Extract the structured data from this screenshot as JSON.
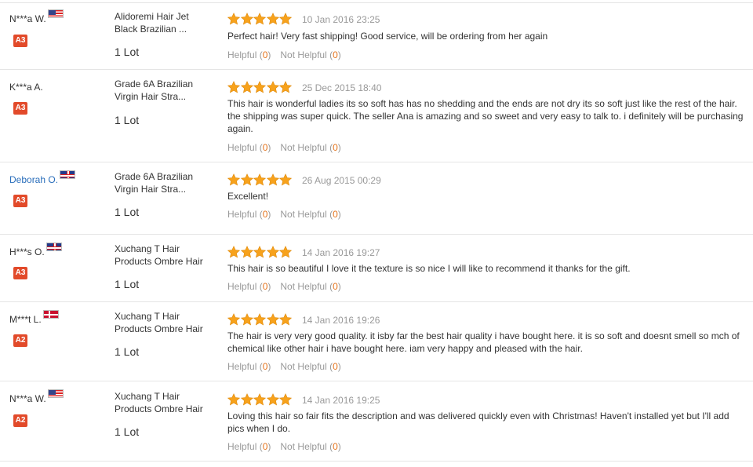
{
  "reviews": [
    {
      "user": "N***a W.",
      "flag": "flag-us",
      "badge": "A3",
      "is_link": false,
      "product": "Alidoremi Hair Jet Black Brazilian ...",
      "quantity": "1 Lot",
      "rating": 5,
      "date": "10 Jan 2016 23:25",
      "text": "Perfect hair! Very fast shipping! Good service, will be ordering from her again",
      "helpful_label": "Helpful",
      "helpful_count": "0",
      "not_helpful_label": "Not Helpful",
      "not_helpful_count": "0"
    },
    {
      "user": "K***a A.",
      "flag": "",
      "badge": "A3",
      "is_link": false,
      "product": "Grade 6A Brazilian Virgin Hair Stra...",
      "quantity": "1 Lot",
      "rating": 5,
      "date": "25 Dec 2015 18:40",
      "text": "This hair is wonderful ladies its so soft has has no shedding and the ends are not dry its so soft just like the rest of the hair. the shipping was super quick. The seller Ana is amazing and so sweet and very easy to talk to. i definitely will be purchasing again.",
      "helpful_label": "Helpful",
      "helpful_count": "0",
      "not_helpful_label": "Not Helpful",
      "not_helpful_count": "0"
    },
    {
      "user": "Deborah O.",
      "flag": "flag-uk",
      "badge": "A3",
      "is_link": true,
      "product": "Grade 6A Brazilian Virgin Hair Stra...",
      "quantity": "1 Lot",
      "rating": 5,
      "date": "26 Aug 2015 00:29",
      "text": "Excellent!",
      "helpful_label": "Helpful",
      "helpful_count": "0",
      "not_helpful_label": "Not Helpful",
      "not_helpful_count": "0"
    },
    {
      "user": "H***s O.",
      "flag": "flag-uk",
      "badge": "A3",
      "is_link": false,
      "product": "Xuchang T Hair Products Ombre Hair",
      "quantity": "1 Lot",
      "rating": 5,
      "date": "14 Jan 2016 19:27",
      "text": "This hair is so beautiful I love it the texture is so nice I will like to recommend it thanks for the gift.",
      "helpful_label": "Helpful",
      "helpful_count": "0",
      "not_helpful_label": "Not Helpful",
      "not_helpful_count": "0"
    },
    {
      "user": "M***t L.",
      "flag": "flag-dk",
      "badge": "A2",
      "is_link": false,
      "product": "Xuchang T Hair Products Ombre Hair",
      "quantity": "1 Lot",
      "rating": 5,
      "date": "14 Jan 2016 19:26",
      "text": "The hair is very very good quality. it isby far the best hair quality i have bought here. it is so soft and doesnt smell so mch of chemical like other hair i have bought here. iam very happy and pleased with the hair.",
      "helpful_label": "Helpful",
      "helpful_count": "0",
      "not_helpful_label": "Not Helpful",
      "not_helpful_count": "0"
    },
    {
      "user": "N***a W.",
      "flag": "flag-us",
      "badge": "A2",
      "is_link": false,
      "product": "Xuchang T Hair Products Ombre Hair",
      "quantity": "1 Lot",
      "rating": 5,
      "date": "14 Jan 2016 19:25",
      "text": "Loving this hair so fair fits the description and was delivered quickly even with Christmas! Haven't installed yet but I'll add pics when I do.",
      "helpful_label": "Helpful",
      "helpful_count": "0",
      "not_helpful_label": "Not Helpful",
      "not_helpful_count": "0"
    }
  ],
  "colors": {
    "star": "#f7a21c",
    "badge": "#e24a2a",
    "link": "#2a6ebb",
    "count": "#e4731c",
    "muted": "#999999"
  }
}
